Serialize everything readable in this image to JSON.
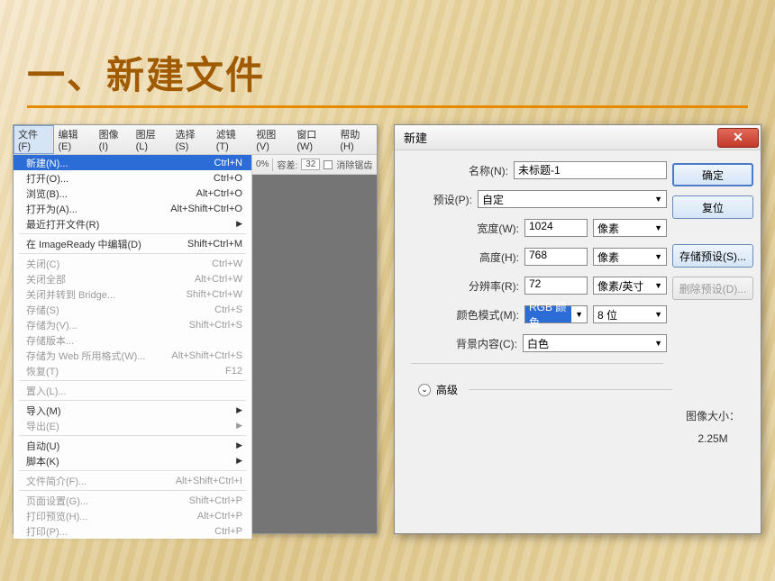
{
  "slide": {
    "title": "一、新建文件"
  },
  "menubar": {
    "items": [
      "文件(F)",
      "编辑(E)",
      "图像(I)",
      "图层(L)",
      "选择(S)",
      "滤镜(T)",
      "视图(V)",
      "窗口(W)",
      "帮助(H)"
    ]
  },
  "toolbar": {
    "zoom": "0%",
    "tolerance_label": "容差:",
    "tolerance_value": "32",
    "antialias": "消除锯齿"
  },
  "menu": {
    "items": [
      {
        "label": "新建(N)...",
        "shortcut": "Ctrl+N",
        "highlight": true
      },
      {
        "label": "打开(O)...",
        "shortcut": "Ctrl+O"
      },
      {
        "label": "浏览(B)...",
        "shortcut": "Alt+Ctrl+O"
      },
      {
        "label": "打开为(A)...",
        "shortcut": "Alt+Shift+Ctrl+O"
      },
      {
        "label": "最近打开文件(R)",
        "submenu": true
      },
      {
        "sep": true
      },
      {
        "label": "在 ImageReady 中编辑(D)",
        "shortcut": "Shift+Ctrl+M"
      },
      {
        "sep": true
      },
      {
        "label": "关闭(C)",
        "shortcut": "Ctrl+W",
        "disabled": true
      },
      {
        "label": "关闭全部",
        "shortcut": "Alt+Ctrl+W",
        "disabled": true
      },
      {
        "label": "关闭并转到 Bridge...",
        "shortcut": "Shift+Ctrl+W",
        "disabled": true
      },
      {
        "label": "存储(S)",
        "shortcut": "Ctrl+S",
        "disabled": true
      },
      {
        "label": "存储为(V)...",
        "shortcut": "Shift+Ctrl+S",
        "disabled": true
      },
      {
        "label": "存储版本...",
        "disabled": true
      },
      {
        "label": "存储为 Web 所用格式(W)...",
        "shortcut": "Alt+Shift+Ctrl+S",
        "disabled": true
      },
      {
        "label": "恢复(T)",
        "shortcut": "F12",
        "disabled": true
      },
      {
        "sep": true
      },
      {
        "label": "置入(L)...",
        "disabled": true
      },
      {
        "sep": true
      },
      {
        "label": "导入(M)",
        "submenu": true
      },
      {
        "label": "导出(E)",
        "submenu": true,
        "disabled": true
      },
      {
        "sep": true
      },
      {
        "label": "自动(U)",
        "submenu": true
      },
      {
        "label": "脚本(K)",
        "submenu": true
      },
      {
        "sep": true
      },
      {
        "label": "文件简介(F)...",
        "shortcut": "Alt+Shift+Ctrl+I",
        "disabled": true
      },
      {
        "sep": true
      },
      {
        "label": "页面设置(G)...",
        "shortcut": "Shift+Ctrl+P",
        "disabled": true
      },
      {
        "label": "打印预览(H)...",
        "shortcut": "Alt+Ctrl+P",
        "disabled": true
      },
      {
        "label": "打印(P)...",
        "shortcut": "Ctrl+P",
        "disabled": true
      }
    ]
  },
  "dialog": {
    "title": "新建",
    "name_label": "名称(N):",
    "name_value": "未标题-1",
    "preset_label": "预设(P):",
    "preset_value": "自定",
    "width_label": "宽度(W):",
    "width_value": "1024",
    "width_unit": "像素",
    "height_label": "高度(H):",
    "height_value": "768",
    "height_unit": "像素",
    "resolution_label": "分辨率(R):",
    "resolution_value": "72",
    "resolution_unit": "像素/英寸",
    "colormode_label": "颜色模式(M):",
    "colormode_value": "RGB 颜色",
    "colormode_bits": "8 位",
    "bgcontent_label": "背景内容(C):",
    "bgcontent_value": "白色",
    "advanced_label": "高级",
    "size_label": "图像大小：",
    "size_value": "2.25M",
    "buttons": {
      "ok": "确定",
      "reset": "复位",
      "save_preset": "存储预设(S)...",
      "delete_preset": "删除预设(D)..."
    }
  }
}
